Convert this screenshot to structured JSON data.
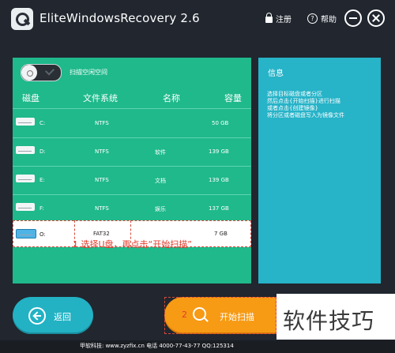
{
  "titlebar": {
    "app_title": "EliteWindowsRecovery  2.6",
    "register_label": "注册",
    "help_label": "帮助"
  },
  "left_panel": {
    "toggle_label": "扫描空闲空间",
    "columns": [
      "磁盘",
      "文件系统",
      "名称",
      "容量"
    ],
    "rows": [
      {
        "drive": "C:",
        "fs": "NTFS",
        "name": "",
        "size": "50 GB"
      },
      {
        "drive": "D:",
        "fs": "NTFS",
        "name": "软件",
        "size": "139 GB"
      },
      {
        "drive": "E:",
        "fs": "NTFS",
        "name": "文档",
        "size": "139 GB"
      },
      {
        "drive": "F:",
        "fs": "NTFS",
        "name": "娱乐",
        "size": "137 GB"
      },
      {
        "drive": "O:",
        "fs": "FAT32",
        "name": "",
        "size": "7 GB",
        "selected": true
      }
    ],
    "annotation_1": "1 选择U盘，再点击“开始扫描”"
  },
  "info_panel": {
    "title": "信息",
    "lines": [
      "选择目标磁盘或者分区",
      "然后点击{开始扫描}进行扫描",
      "或者点击{创建镜像}",
      "将分区或者磁盘写入为镜像文件"
    ]
  },
  "buttons": {
    "back_label": "返回",
    "scan_label": "开始扫描",
    "annotation_2": "2"
  },
  "watermark": "软件技巧",
  "footer": {
    "text": "甲软科技: www.zyzfix.cn 电话 4000-77-43-77 QQ:125314"
  },
  "colors": {
    "left_panel": "#1fb98b",
    "info_panel": "#27b3c8",
    "scan_button": "#f79a14",
    "annotation": "#e53b2c"
  }
}
